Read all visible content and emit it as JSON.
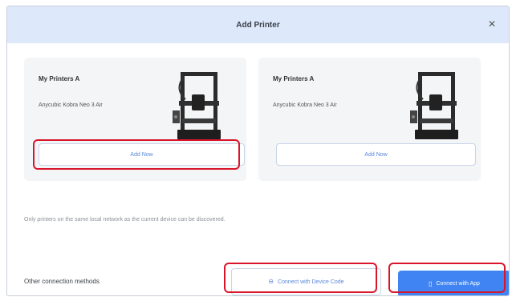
{
  "dialog": {
    "title": "Add Printer",
    "close_glyph": "✕"
  },
  "printers": [
    {
      "name": "My Printers A",
      "model": "Anycubic Kobra Neo 3 Air",
      "add_label": "Add Now",
      "image_icon": "3d-printer-icon"
    },
    {
      "name": "My Printers A",
      "model": "Anycubic Kobra Neo 3 Air",
      "add_label": "Add Now",
      "image_icon": "3d-printer-icon"
    }
  ],
  "note": "Only printers on the same local network as the current device can be discovered.",
  "footer": {
    "other_label": "Other connection methods",
    "code_button": {
      "label": "Connect with Device Code",
      "icon": "link-icon",
      "glyph": "⊖"
    },
    "app_button": {
      "label": "Connect with App",
      "icon": "phone-icon",
      "glyph": "▯"
    }
  },
  "colors": {
    "header_bg": "#dde8fb",
    "accent": "#3f84f2",
    "highlight": "#d9152a",
    "card_bg": "#f4f5f7"
  }
}
